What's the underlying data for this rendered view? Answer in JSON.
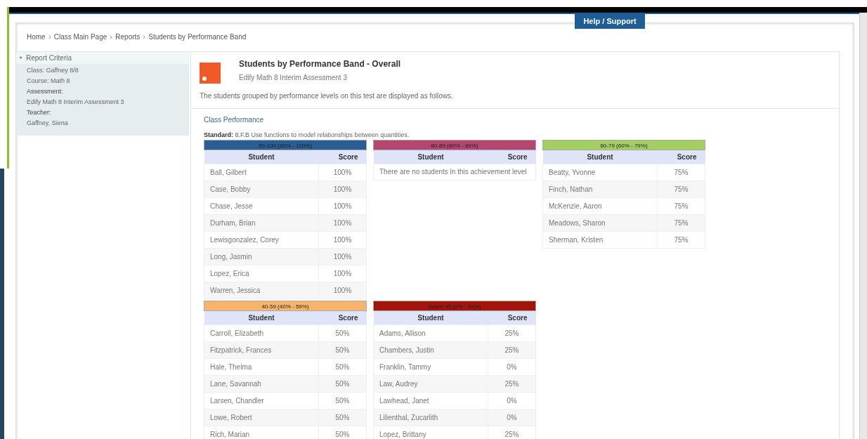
{
  "help_button": "Help / Support",
  "breadcrumb": [
    "Home",
    "Class Main Page",
    "Reports",
    "Students by Performance Band"
  ],
  "report_criteria": {
    "title": "Report Criteria",
    "expanded": true,
    "lines": [
      {
        "text": "Class: Gaffney 8/8",
        "kind": "value"
      },
      {
        "text": "Course: Math 8",
        "kind": "value"
      },
      {
        "text": "Assessment:",
        "kind": "label"
      },
      {
        "text": "Edify Math 8 Interim Assessment 3",
        "kind": "value"
      },
      {
        "text": "Teacher:",
        "kind": "label"
      },
      {
        "text": "Gaffney, Siena",
        "kind": "value"
      }
    ]
  },
  "report": {
    "title": "Students by Performance Band - Overall",
    "subtitle": "Edify Math 8 Interim Assessment 3",
    "description": "The students grouped by performance levels on this test are displayed as follows.",
    "section_title": "Class Performance",
    "standard_label": "Standard:",
    "standard_code": "8.F.B",
    "standard_text": "Use functions to model relationships between quantities.",
    "bands": [
      {
        "title": "90-100 (90% - 100%)",
        "color": "#2a5d93",
        "columns": [
          "Student",
          "Score"
        ],
        "rows": [
          [
            "Ball, Gilbert",
            "100%"
          ],
          [
            "Case, Bobby",
            "100%"
          ],
          [
            "Chase, Jesse",
            "100%"
          ],
          [
            "Durham, Brian",
            "100%"
          ],
          [
            "Lewisgonzalez, Corey",
            "100%"
          ],
          [
            "Long, Jasmin",
            "100%"
          ],
          [
            "Lopez, Erica",
            "100%"
          ],
          [
            "Warren, Jessica",
            "100%"
          ]
        ]
      },
      {
        "title": "80-89 (80% - 89%)",
        "color": "#b4466f",
        "columns": [
          "Student",
          "Score"
        ],
        "empty_message": "There are no students in this achievement level"
      },
      {
        "title": "60-79 (60% - 79%)",
        "color": "#a3cf62",
        "columns": [
          "Student",
          "Score"
        ],
        "rows": [
          [
            "Beatty, Yvonne",
            "75%"
          ],
          [
            "Finch, Nathan",
            "75%"
          ],
          [
            "McKenzie, Aaron",
            "75%"
          ],
          [
            "Meadows, Sharon",
            "75%"
          ],
          [
            "Sherman, Kristen",
            "75%"
          ]
        ]
      },
      {
        "title": "40-59 (40% - 59%)",
        "color": "#f9b46b",
        "columns": [
          "Student",
          "Score"
        ],
        "rows": [
          [
            "Carroll, Elizabeth",
            "50%"
          ],
          [
            "Fitzpatrick, Frances",
            "50%"
          ],
          [
            "Hale, Thelma",
            "50%"
          ],
          [
            "Lane, Savannah",
            "50%"
          ],
          [
            "Larsen, Chandler",
            "50%"
          ],
          [
            "Lowe, Robert",
            "50%"
          ],
          [
            "Rich, Marian",
            "50%"
          ]
        ]
      },
      {
        "title": "Below 40 (0% - 39%)",
        "color": "#a3140c",
        "columns": [
          "Student",
          "Score"
        ],
        "rows": [
          [
            "Adams, Allison",
            "25%"
          ],
          [
            "Chambers, Justin",
            "25%"
          ],
          [
            "Franklin, Tammy",
            "0%"
          ],
          [
            "Law, Audrey",
            "25%"
          ],
          [
            "Lawhead, Janet",
            "0%"
          ],
          [
            "Lilienthal, Zucarlith",
            "0%"
          ],
          [
            "Lopez, Brittany",
            "25%"
          ]
        ]
      }
    ]
  }
}
